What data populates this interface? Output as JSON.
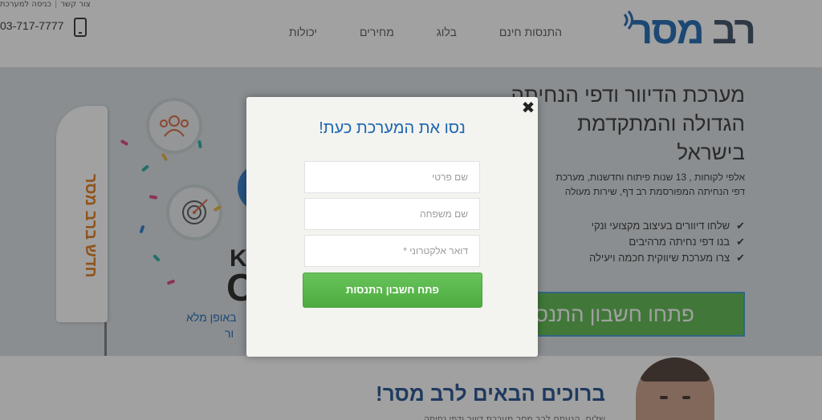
{
  "header": {
    "top_links": [
      "צור קשר",
      "כניסה למערכת"
    ],
    "phone": "03-717-7777",
    "nav": [
      "יכולות",
      "מחירים",
      "בלוג",
      "התנסות חינם"
    ],
    "logo": {
      "rav": "רב",
      "meser": "מסר"
    }
  },
  "hero": {
    "title": "מערכת הדיוור ודפי הנחיתה הגדולה והמתקדמת בישראל",
    "desc_lines": [
      "אלפי לקוחות , 13 שנות פיתוח וחדשנות, מערכת",
      "דפי הנחיתה המפורסמת רב דף, שירות מעולה"
    ],
    "features": [
      "שלחו דיוורים בעיצוב מקצועי ונקי",
      "בנו דפי נחיתה מרהיבים",
      "צרו מערכת שיווקית חכמה ויעילה"
    ],
    "cta_label": "פתחו חשבון התנסות",
    "flag_text": "חדש ברב מסר",
    "left_text_1": "באופן מלא",
    "left_text_2": "ור",
    "big_k": "K",
    "big_c": "C"
  },
  "bottom": {
    "welcome": "ברוכים הבאים לרב מסר!",
    "line": "שלום, הגעתם לרב מסר מערכת דיוור ודפי נחיתה"
  },
  "modal": {
    "close": "✖",
    "title": "נסו את המערכת כעת!",
    "first_name_placeholder": "שם פרטי",
    "last_name_placeholder": "שם משפחה",
    "email_placeholder": "דואר אלקטרוני *",
    "submit_label": "פתח חשבון התנסות"
  },
  "colors": {
    "brand_blue": "#1b66b0",
    "brand_dark": "#3a4a63",
    "cta_green": "#5ab84d",
    "flag_orange": "#e07a1a"
  }
}
